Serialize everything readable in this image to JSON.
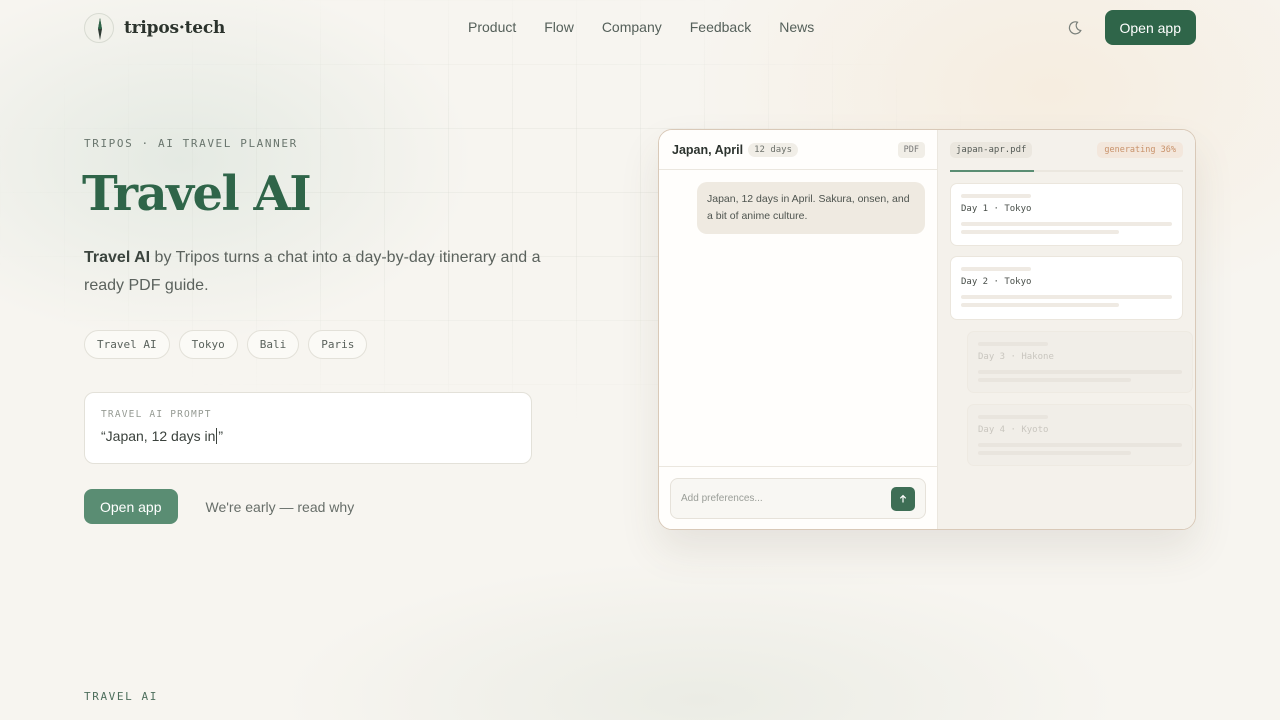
{
  "nav": {
    "brand": "tripos·tech",
    "links": [
      "Product",
      "Flow",
      "Company",
      "Feedback",
      "News"
    ],
    "cta": "Open app"
  },
  "hero": {
    "eyebrow": "TRIPOS · AI TRAVEL PLANNER",
    "title": "Travel AI",
    "desc_bold": "Travel AI",
    "desc_rest": " by Tripos turns a chat into a day-by-day itinerary and a ready PDF guide.",
    "chips": [
      "Travel AI",
      "Tokyo",
      "Bali",
      "Paris"
    ],
    "prompt_label": "TRAVEL AI PROMPT",
    "prompt_text_before": "“Japan, 12 days in",
    "prompt_text_after": "”",
    "cta": "Open app",
    "secondary_link": "We're early — read why"
  },
  "mockup": {
    "chat_title": "Japan, April",
    "days_tag": "12 days",
    "pdf_tag": "PDF",
    "message": "Japan, 12 days in April. Sakura, onsen, and a bit of anime culture.",
    "input_placeholder": "Add preferences...",
    "file_name": "japan-apr.pdf",
    "status": "generating 36%",
    "progress": 0.36,
    "days": [
      "Day 1 · Tokyo",
      "Day 2 · Tokyo",
      "Day 3 · Hakone",
      "Day 4 · Kyoto"
    ]
  },
  "section_label": "TRAVEL AI",
  "colors": {
    "accent": "#2f6549",
    "accent_soft": "#5a8d73",
    "background": "#f7f5f0",
    "status": "#c8926a"
  },
  "icons": {
    "brand": "compass-icon",
    "theme": "moon-icon",
    "send": "arrow-up-icon"
  }
}
